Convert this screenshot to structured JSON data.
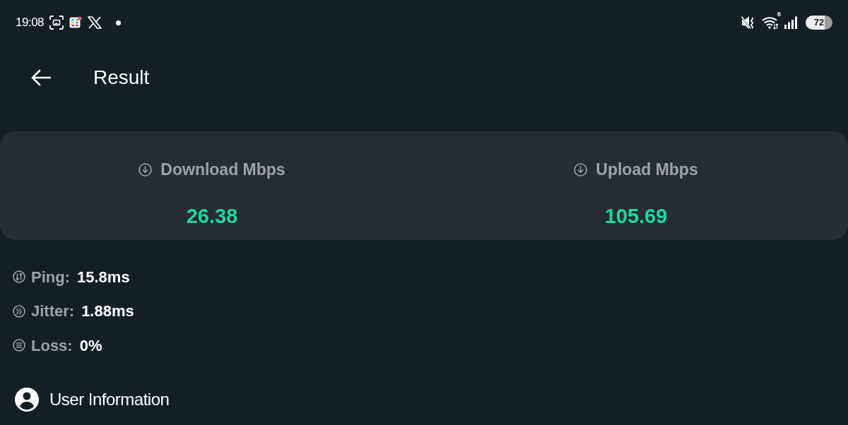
{
  "status_bar": {
    "time": "19:08",
    "wifi_badge": "6",
    "battery": "72"
  },
  "header": {
    "title": "Result"
  },
  "speeds": [
    {
      "label": "Download Mbps",
      "value": "26.38"
    },
    {
      "label": "Upload Mbps",
      "value": "105.69"
    }
  ],
  "stats": [
    {
      "kind": "ping",
      "label": "Ping:",
      "value": "15.8ms"
    },
    {
      "kind": "jitter",
      "label": "Jitter:",
      "value": "1.88ms"
    },
    {
      "kind": "loss",
      "label": "Loss:",
      "value": "0%"
    }
  ],
  "user_section": {
    "title": "User Information"
  }
}
